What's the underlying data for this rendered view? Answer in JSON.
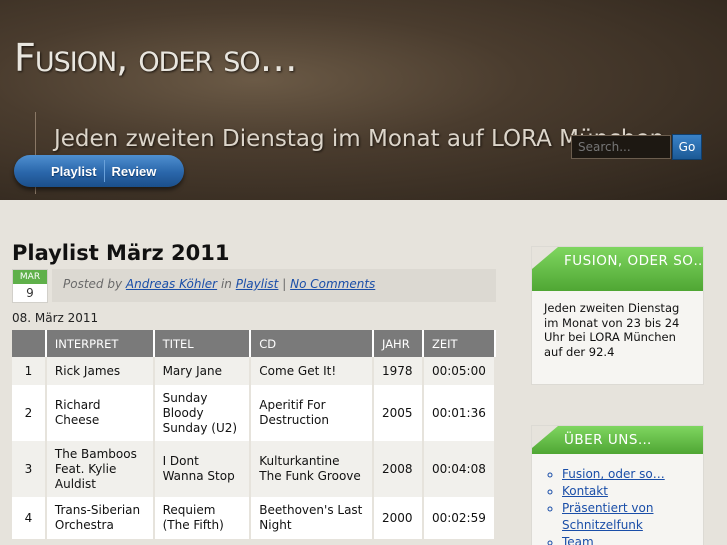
{
  "header": {
    "site_title": "Fusion, oder so…",
    "tagline": "Jeden zweiten Dienstag im Monat auf LORA München",
    "search_placeholder": "Search...",
    "search_button": "Go"
  },
  "nav": {
    "items": [
      "Playlist",
      "Review"
    ]
  },
  "post": {
    "title": "Playlist März 2011",
    "date_month": "MAR",
    "date_day": "9",
    "meta_posted_by": "Posted by",
    "meta_author": "Andreas Köhler",
    "meta_in": "in",
    "meta_category": "Playlist",
    "meta_sep": "|",
    "meta_comments": "No Comments",
    "date_line": "08. März 2011"
  },
  "table": {
    "headers": [
      "",
      "INTERPRET",
      "TITEL",
      "CD",
      "JAHR",
      "ZEIT"
    ],
    "rows": [
      [
        "1",
        "Rick James",
        "Mary Jane",
        "Come Get It!",
        "1978",
        "00:05:00"
      ],
      [
        "2",
        "Richard Cheese",
        "Sunday Bloody Sunday (U2)",
        "Aperitif For Destruction",
        "2005",
        "00:01:36"
      ],
      [
        "3",
        "The Bamboos Feat. Kylie Auldist",
        "I Dont Wanna Stop",
        "Kulturkantine The Funk Groove",
        "2008",
        "00:04:08"
      ],
      [
        "4",
        "Trans-Siberian Orchestra",
        "Requiem (The Fifth)",
        "Beethoven's Last Night",
        "2000",
        "00:02:59"
      ]
    ]
  },
  "sidebar": {
    "widget1_title": "FUSION, ODER SO…",
    "widget1_text": "Jeden zweiten Dienstag im Monat von 23 bis 24 Uhr bei LORA München auf der 92.4",
    "widget2_title": "ÜBER UNS…",
    "widget2_links": [
      "Fusion, oder so…",
      "Kontakt",
      "Präsentiert von Schnitzelfunk",
      "Team"
    ]
  },
  "colors": {
    "accent_green": "#5fb04a",
    "nav_blue": "#2a66aa",
    "link_blue": "#1a4ea8"
  }
}
